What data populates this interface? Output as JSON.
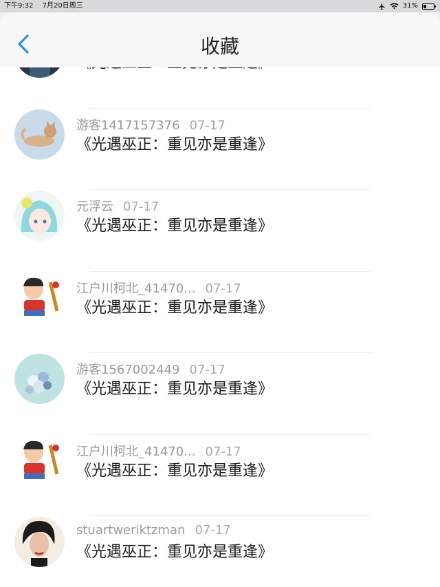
{
  "status_bar": {
    "time": "下午9:32",
    "date": "7月20日周三",
    "battery": "31%",
    "battery_level": 0.31
  },
  "nav": {
    "title": "收藏"
  },
  "items": [
    {
      "username": "",
      "date": "",
      "title": "《光遇巫正：重见亦是重逢》",
      "avatar_icon": "dark-portrait-avatar"
    },
    {
      "username": "游客1417157376",
      "date": "07-17",
      "title": "《光遇巫正：重见亦是重逢》",
      "avatar_icon": "cat-avatar"
    },
    {
      "username": "元浮云",
      "date": "07-17",
      "title": "《光遇巫正：重见亦是重逢》",
      "avatar_icon": "anime-girl-avatar"
    },
    {
      "username": "江户川柯北_41470...",
      "date": "07-17",
      "title": "《光遇巫正：重见亦是重逢》",
      "avatar_icon": "cartoon-boy-avatar"
    },
    {
      "username": "游客1567002449",
      "date": "07-17",
      "title": "《光遇巫正：重见亦是重逢》",
      "avatar_icon": "flower-bouquet-avatar"
    },
    {
      "username": "江户川柯北_41470...",
      "date": "07-17",
      "title": "《光遇巫正：重见亦是重逢》",
      "avatar_icon": "cartoon-boy-avatar"
    },
    {
      "username": "stuartweriktzman",
      "date": "07-17",
      "title": "《光遇巫正：重见亦是重逢》",
      "avatar_icon": "woman-portrait-avatar"
    }
  ]
}
